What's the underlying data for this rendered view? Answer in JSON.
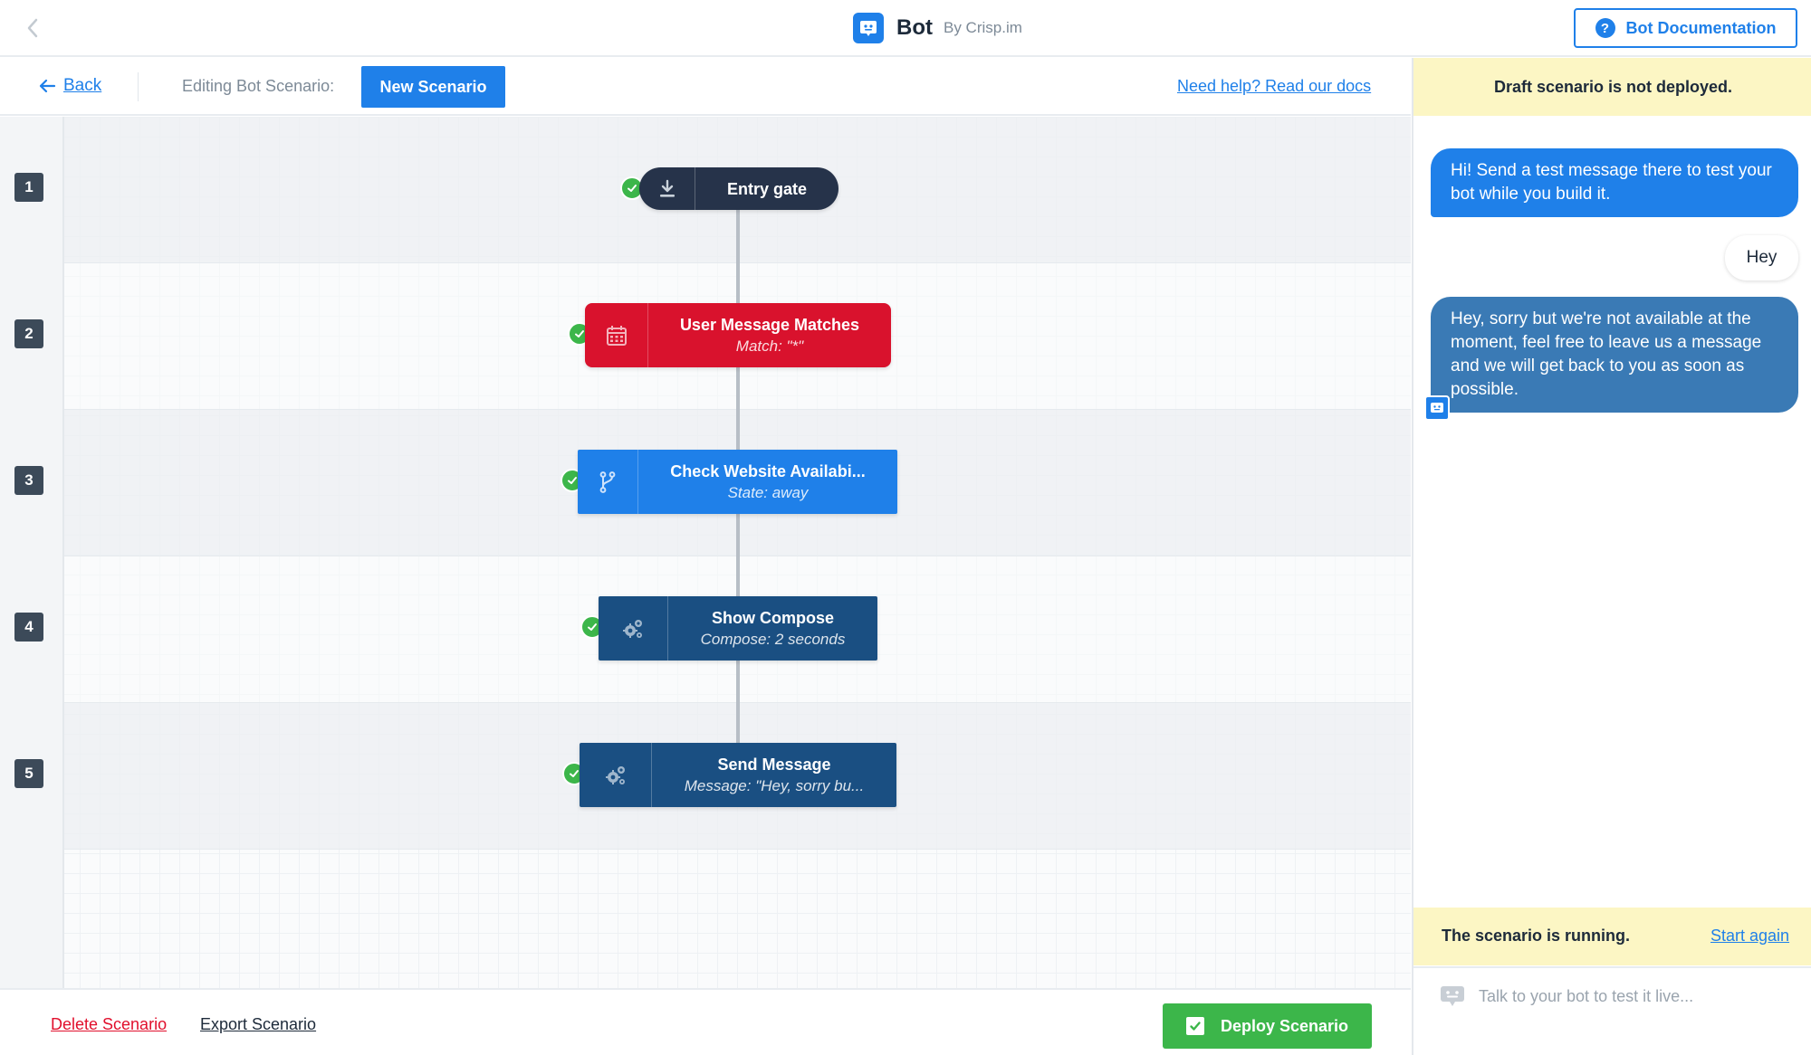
{
  "colors": {
    "accent": "#1f80e9",
    "entry_node": "#26334a",
    "condition_node": "#d9122d",
    "branch_node": "#1f80e9",
    "action_node": "#1a4f82",
    "success": "#3cb64a",
    "banner": "#fcf6c4",
    "danger": "#e10f2c"
  },
  "header": {
    "brand_name": "Bot",
    "brand_by": "By Crisp.im",
    "doc_button": "Bot Documentation",
    "doc_icon": "question-icon"
  },
  "subheader": {
    "back_label": "Back",
    "editing_label": "Editing Bot Scenario:",
    "scenario_name": "New Scenario",
    "help_link": "Need help? Read our docs"
  },
  "rows": [
    "1",
    "2",
    "3",
    "4",
    "5"
  ],
  "nodes": [
    {
      "title": "Entry gate",
      "subtitle": "",
      "icon": "download-icon",
      "status": "valid"
    },
    {
      "title": "User Message Matches",
      "subtitle": "Match: \"*\"",
      "icon": "calendar-icon",
      "status": "valid"
    },
    {
      "title": "Check Website Availabi...",
      "subtitle": "State: away",
      "icon": "branch-icon",
      "status": "valid"
    },
    {
      "title": "Show Compose",
      "subtitle": "Compose: 2 seconds",
      "icon": "gears-icon",
      "status": "valid"
    },
    {
      "title": "Send Message",
      "subtitle": "Message: \"Hey, sorry bu...",
      "icon": "gears-icon",
      "status": "valid"
    }
  ],
  "footer": {
    "delete_label": "Delete Scenario",
    "export_label": "Export Scenario",
    "deploy_label": "Deploy Scenario"
  },
  "panel": {
    "draft_banner": "Draft scenario is not deployed.",
    "messages": [
      {
        "from": "bot",
        "text": "Hi! Send a test message there to test your bot while you build it."
      },
      {
        "from": "user",
        "text": "Hey"
      },
      {
        "from": "bot",
        "text": "Hey, sorry but we're not available at the moment, feel free to leave us a message and we will get back to you as soon as possible."
      }
    ],
    "running_text": "The scenario is running.",
    "start_again": "Start again",
    "input_placeholder": "Talk to your bot to test it live..."
  }
}
